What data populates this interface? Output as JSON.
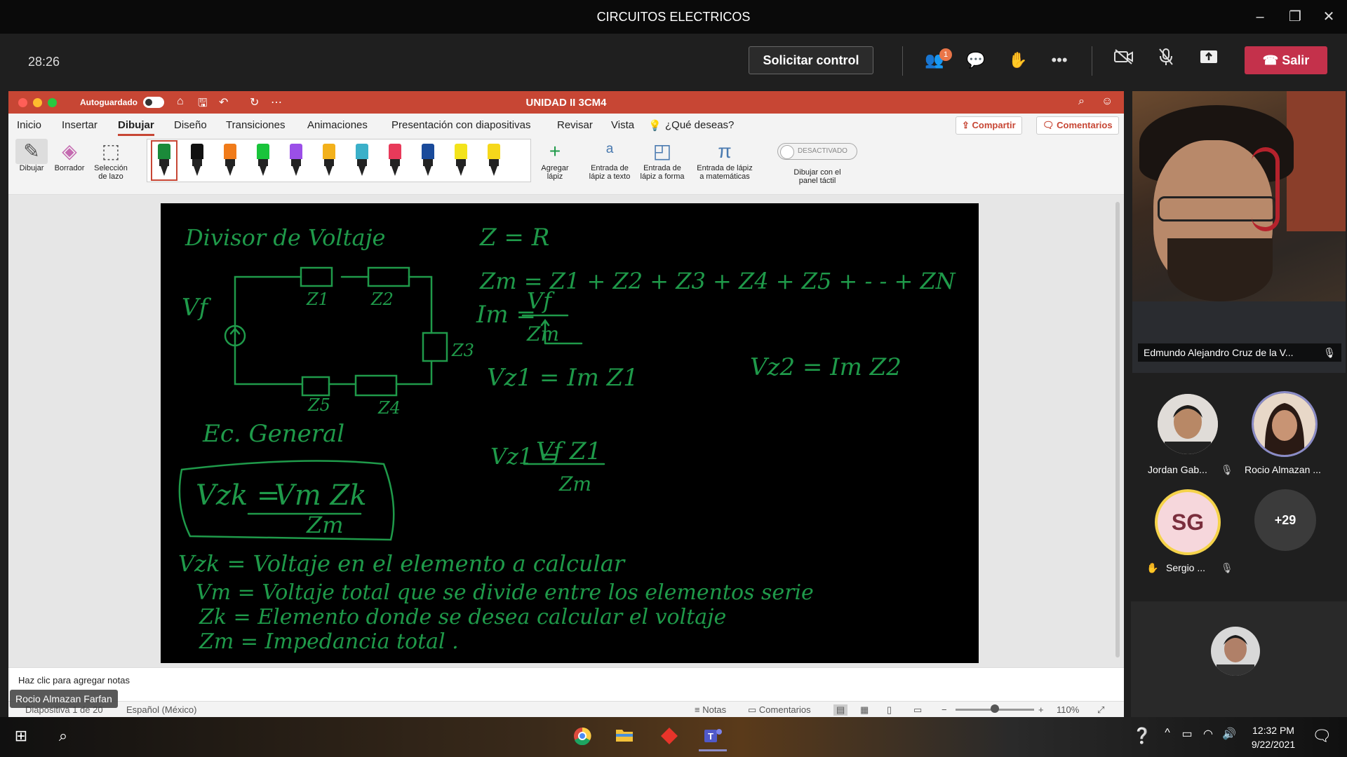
{
  "window": {
    "title": "CIRCUITOS ELECTRICOS"
  },
  "meeting": {
    "timer": "28:26",
    "request_control": "Solicitar control",
    "participants_badge": "1",
    "leave": "Salir"
  },
  "ppt": {
    "autosave_label": "Autoguardado",
    "autosave_state": "o",
    "document_title": "UNIDAD II 3CM4",
    "tabs": [
      "Inicio",
      "Insertar",
      "Dibujar",
      "Diseño",
      "Transiciones",
      "Animaciones",
      "Presentación con diapositivas",
      "Revisar",
      "Vista",
      "¿Qué deseas?"
    ],
    "share": "Compartir",
    "comments": "Comentarios",
    "tools": {
      "draw": "Dibujar",
      "eraser": "Borrador",
      "lasso_1": "Selección",
      "lasso_2": "de lazo",
      "add_pen_1": "Agregar",
      "add_pen_2": "lápiz",
      "ink_text_1": "Entrada de",
      "ink_text_2": "lápiz a texto",
      "ink_shape_1": "Entrada de",
      "ink_shape_2": "lápiz a forma",
      "ink_math_1": "Entrada de lápiz",
      "ink_math_2": "a matemáticas",
      "touch_toggle": "DESACTIVADO",
      "touch_1": "Dibujar con el",
      "touch_2": "panel táctil"
    },
    "pens": [
      {
        "color": "#1b8a3a"
      },
      {
        "color": "#111111"
      },
      {
        "color": "#f07b1a"
      },
      {
        "color": "#19c43b"
      },
      {
        "color": "#9b4fe8"
      },
      {
        "color": "#f3b11b"
      },
      {
        "color": "#3bb0c9"
      },
      {
        "color": "#e83a5a"
      },
      {
        "color": "#1a4b9b"
      },
      {
        "color": "#f3e31b"
      },
      {
        "color": "#f6d81b"
      }
    ],
    "notes_placeholder": "Haz clic para agregar notas",
    "status": {
      "slide": "Diapositiva 1 de 20",
      "language": "Español (México)",
      "notes": "Notas",
      "comments": "Comentarios",
      "zoom": "110%"
    },
    "presenter_name": "Rocio Almazan Farfan"
  },
  "slide": {
    "ink_color": "#1f9a4a",
    "lines": {
      "title": "Divisor de Voltaje",
      "z_eq_r": "Z = R",
      "zt_sum": "Zт = Z1 + Z2 + Z3 + Z4 + Z5 + - - + ZN",
      "it": "Iт =",
      "it_num": "Vf",
      "it_den": "Zт",
      "vz1": "Vz1 = Iт Z1",
      "vz2": "Vz2 = Iт Z2",
      "vz1b": "Vz1 =",
      "vz1b_num": "Vf Z1",
      "vz1b_den": "Zт",
      "ec_general": "Ec. General",
      "formula_left": "Vzk =",
      "formula_num": "Vт Zk",
      "formula_den": "Zт",
      "def1": "Vzk = Voltaje en el elemento a calcular",
      "def2": "Vт = Voltaje total que se divide entre los elementos serie",
      "def3": "Zk = Elemento donde se desea calcular el voltaje",
      "def4": "Zт = Impedancia total .",
      "circuit_vf": "Vf",
      "z1": "Z1",
      "z2": "Z2",
      "z3": "Z3",
      "z4": "Z4",
      "z5": "Z5"
    }
  },
  "participants": {
    "video_name": "Edmundo Alejandro Cruz de la V...",
    "p1": "Jordan Gab...",
    "p2": "Rocio Almazan ...",
    "p3_initials": "SG",
    "p3": "Sergio ...",
    "more": "+29"
  },
  "taskbar": {
    "time": "12:32 PM",
    "date": "9/22/2021"
  }
}
